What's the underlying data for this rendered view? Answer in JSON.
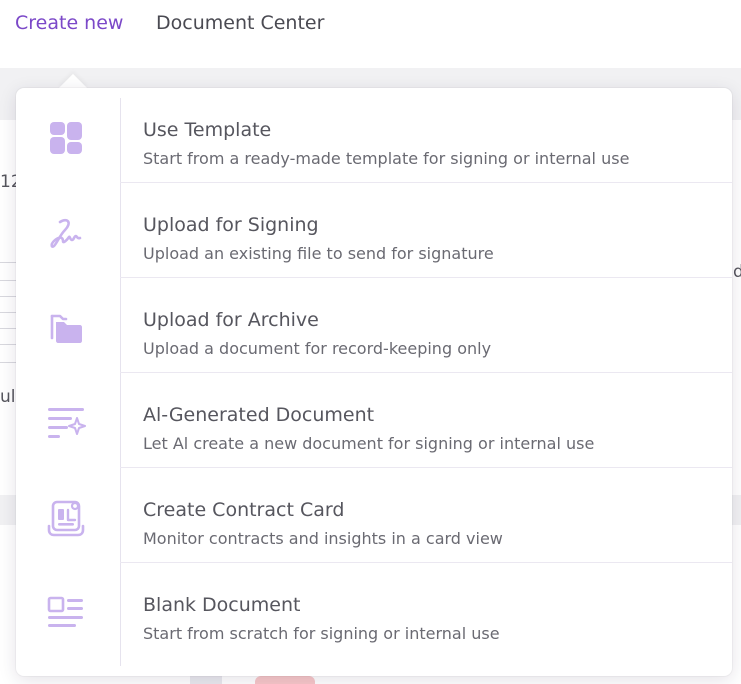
{
  "nav": {
    "create_new": "Create new",
    "document_center": "Document Center"
  },
  "background": {
    "frag_a": "12",
    "frag_b": "ul",
    "frag_c": "d"
  },
  "colors": {
    "accent": "#7b48c8",
    "icon_fill": "#c9b3ee",
    "title_text": "#56565e",
    "desc_text": "#6a6a72"
  },
  "menu": {
    "items": [
      {
        "icon": "template-grid-icon",
        "title": "Use Template",
        "description": "Start from a ready-made template for signing or internal use"
      },
      {
        "icon": "signature-icon",
        "title": "Upload for Signing",
        "description": "Upload an existing file to send for signature"
      },
      {
        "icon": "folder-icon",
        "title": "Upload for Archive",
        "description": "Upload a document for record-keeping only"
      },
      {
        "icon": "ai-sparkle-lines-icon",
        "title": "Al-Generated Document",
        "description": "Let Al create a new document for signing or internal use"
      },
      {
        "icon": "contract-card-icon",
        "title": "Create Contract Card",
        "description": "Monitor contracts and insights in a card view"
      },
      {
        "icon": "blank-document-icon",
        "title": "Blank Document",
        "description": "Start from scratch for signing or internal use"
      }
    ]
  }
}
